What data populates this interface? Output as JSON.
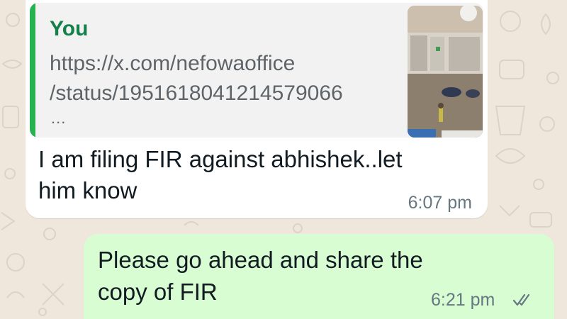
{
  "quoted_message": {
    "author": "You",
    "link_line1": "https://x.com/nefowaoffice",
    "link_line2": "/status/1951618041214579066",
    "ellipsis": "..."
  },
  "incoming_message": {
    "line1": "I am filing FIR against abhishek..let",
    "line2": "him know",
    "time": "6:07 pm"
  },
  "outgoing_message": {
    "line1": "Please go ahead and share the",
    "line2": "copy of FIR",
    "time": "6:21 pm",
    "status_icon": "double-check-icon"
  },
  "colors": {
    "wallpaper": "#efe7dc",
    "incoming_bubble": "#ffffff",
    "outgoing_bubble": "#d8fdd2",
    "quote_bar": "#25b24f",
    "quote_author": "#15804a",
    "timestamp": "#667781"
  }
}
